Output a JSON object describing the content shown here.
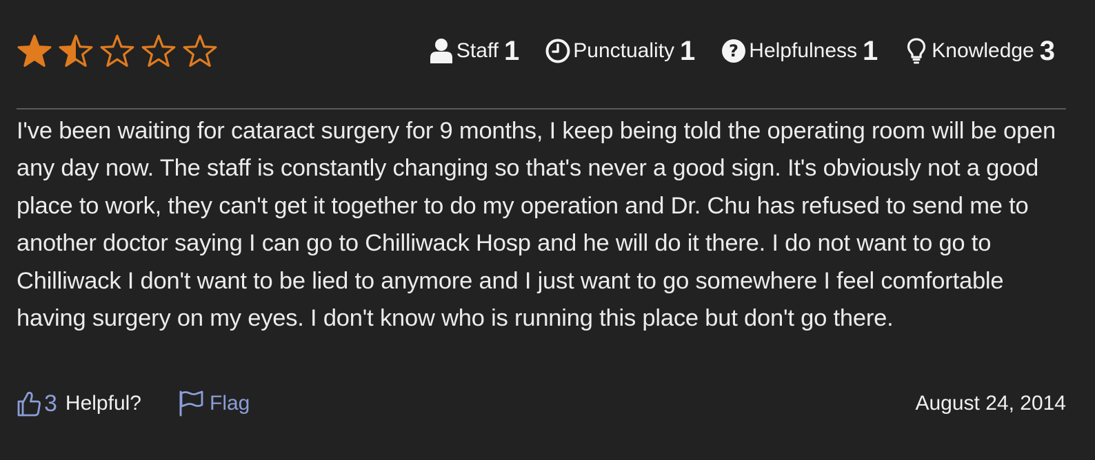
{
  "review": {
    "overall_rating": 1.5,
    "overall_rating_max": 5,
    "star_color": "#e07b1f",
    "ratings": [
      {
        "icon": "user-icon",
        "label": "Staff",
        "value": "1"
      },
      {
        "icon": "clock-icon",
        "label": "Punctuality",
        "value": "1"
      },
      {
        "icon": "question-circle-icon",
        "label": "Helpfulness",
        "value": "1"
      },
      {
        "icon": "lightbulb-icon",
        "label": "Knowledge",
        "value": "3"
      }
    ],
    "text": "I've been waiting for cataract surgery for 9 months, I keep being told the operating room will be open any day now. The staff is constantly changing so that's never a good sign. It's obviously not a good place to work, they can't get it together to do my operation and Dr. Chu has refused to send me to another doctor saying I can go to Chilliwack Hosp and he will do it there. I do not want to go to Chilliwack I don't want to be lied to anymore and I just want to go somewhere I feel comfortable having surgery on my eyes. I don't know who is running this place but don't go there.",
    "helpful_count": "3",
    "helpful_label": "Helpful?",
    "flag_label": "Flag",
    "date": "August 24, 2014",
    "link_color": "#8c9ed8"
  }
}
